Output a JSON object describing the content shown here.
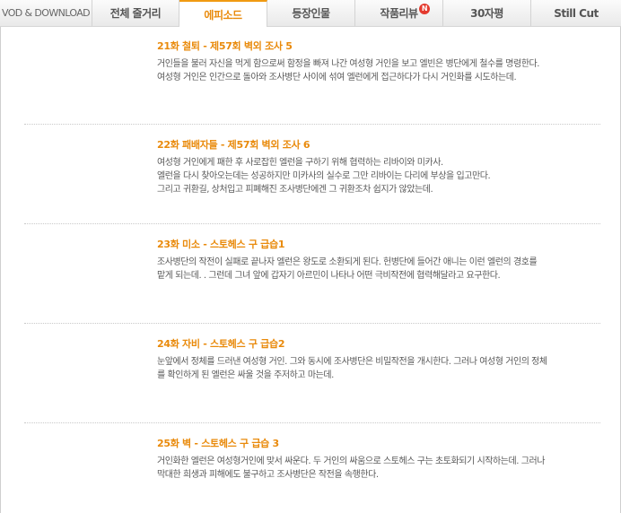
{
  "tabs": [
    {
      "label": "VOD & DOWNLOAD",
      "active": false
    },
    {
      "label": "전체 줄거리",
      "active": false
    },
    {
      "label": "에피소드",
      "active": true
    },
    {
      "label": "등장인물",
      "active": false
    },
    {
      "label": "작품리뷰",
      "active": false,
      "badge": "N"
    },
    {
      "label": "30자평",
      "active": false
    },
    {
      "label": "Still Cut",
      "active": false
    }
  ],
  "episodes": [
    {
      "title": "21화 철퇴 - 제57회 벽외 조사 5",
      "lines": [
        "거인들을 불러 자신을 먹게 함으로써 함정을 빠져 나간 여성형 거인을 보고 엘빈은 병단에게 철수를 명령한다.",
        "여성형 거인은 인간으로 돌아와 조사병단 사이에 섞여 엘런에게 접근하다가 다시 거인화를 시도하는데."
      ]
    },
    {
      "title": "22화 패배자들 - 제57회 벽외 조사 6",
      "lines": [
        "여성형 거인에게 패한 후 사로잡힌 엘런을 구하기 위해 협력하는 리바이와 미카사.",
        "엘런을 다시 찾아오는데는 성공하지만 미카사의 실수로 그만 리바이는 다리에 부상을 입고만다.",
        "그리고 귀환길, 상처입고 피폐해진 조사병단에겐 그 귀환조차 쉽지가 않았는데."
      ]
    },
    {
      "title": "23화 미소 - 스토헤스 구 급습1",
      "lines": [
        "조사병단의 작전이 실패로 끝나자 엘런은 왕도로 소환되게 된다. 헌병단에 들어간 애니는 이런 엘런의 경호를",
        "맡게 되는데. . 그런데 그녀 앞에 갑자기 아르민이 나타나 어떤 극비작전에 협력해달라고 요구한다."
      ]
    },
    {
      "title": "24화 자비 - 스토헤스 구 급습2",
      "lines": [
        "눈앞에서 정체를 드러낸 여성형 거인. 그와 동시에 조사병단은 비밀작전을 개시한다. 그러나 여성형 거인의 정체",
        "를 확인하게 된 엘런은 싸울 것을 주저하고 마는데."
      ]
    },
    {
      "title": "25화 벽 - 스토헤스 구 급습 3",
      "lines": [
        "거인화한 엘런은 여성형거인에 맞서 싸운다. 두 거인의 싸움으로 스토헤스 구는 초토화되기 시작하는데. 그러나",
        "막대한 희생과 피해에도 불구하고 조사병단은 작전을 속행한다."
      ]
    }
  ]
}
